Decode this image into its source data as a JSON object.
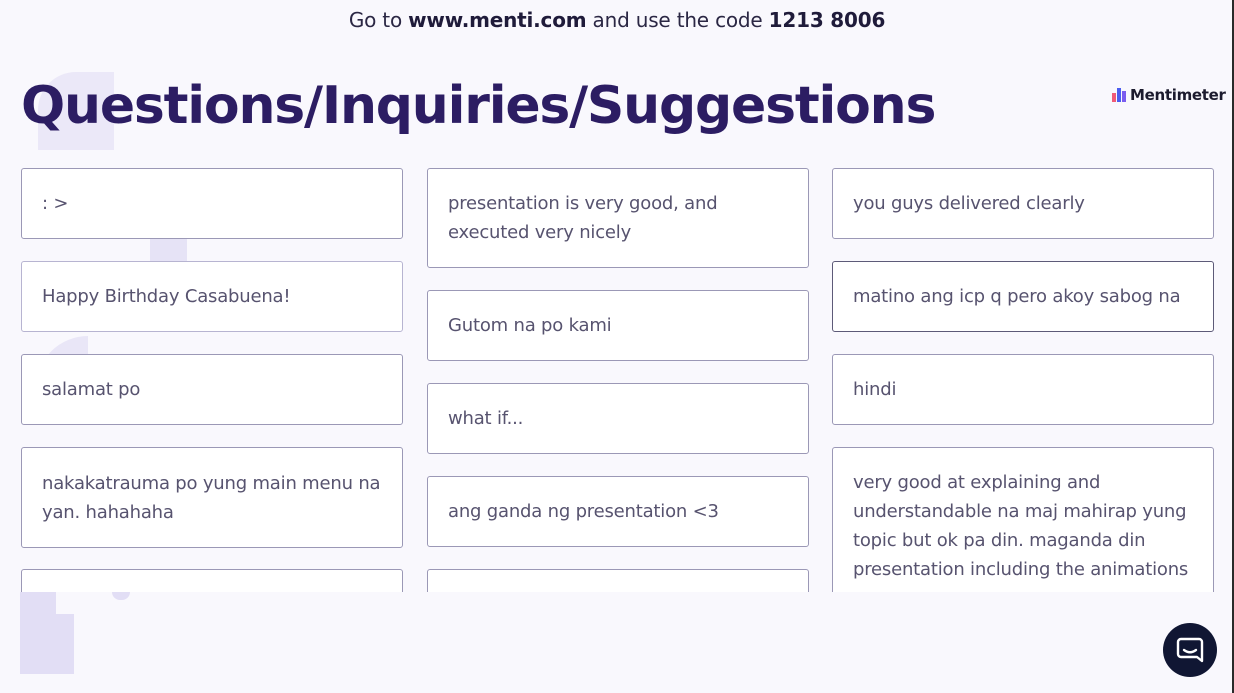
{
  "join_bar": {
    "prefix": "Go to ",
    "url": "www.menti.com",
    "middle": " and use the code ",
    "code": "1213 8006"
  },
  "title": "Questions/Inquiries/Suggestions",
  "logo": {
    "text": "Mentimeter",
    "colors": [
      "#f05a78",
      "#4b5cf0",
      "#7a5cf0"
    ]
  },
  "responses": {
    "column_1": [
      ": >",
      "Happy Birthday Casabuena!",
      "salamat po",
      "nakakatrauma po yung main menu na yan. hahahaha",
      ""
    ],
    "column_2": [
      "presentation is very good, and executed very nicely",
      "Gutom na po kami",
      "what if...",
      "ang ganda ng presentation <3",
      ""
    ],
    "column_3": [
      "you guys delivered clearly",
      "matino ang icp q pero akoy sabog na",
      "hindi",
      "very good at explaining and understandable na maj mahirap yung topic but ok pa din. maganda din presentation including the animations"
    ]
  },
  "chat_button": {
    "icon": "chat-bubble-icon",
    "color": "#101633"
  }
}
